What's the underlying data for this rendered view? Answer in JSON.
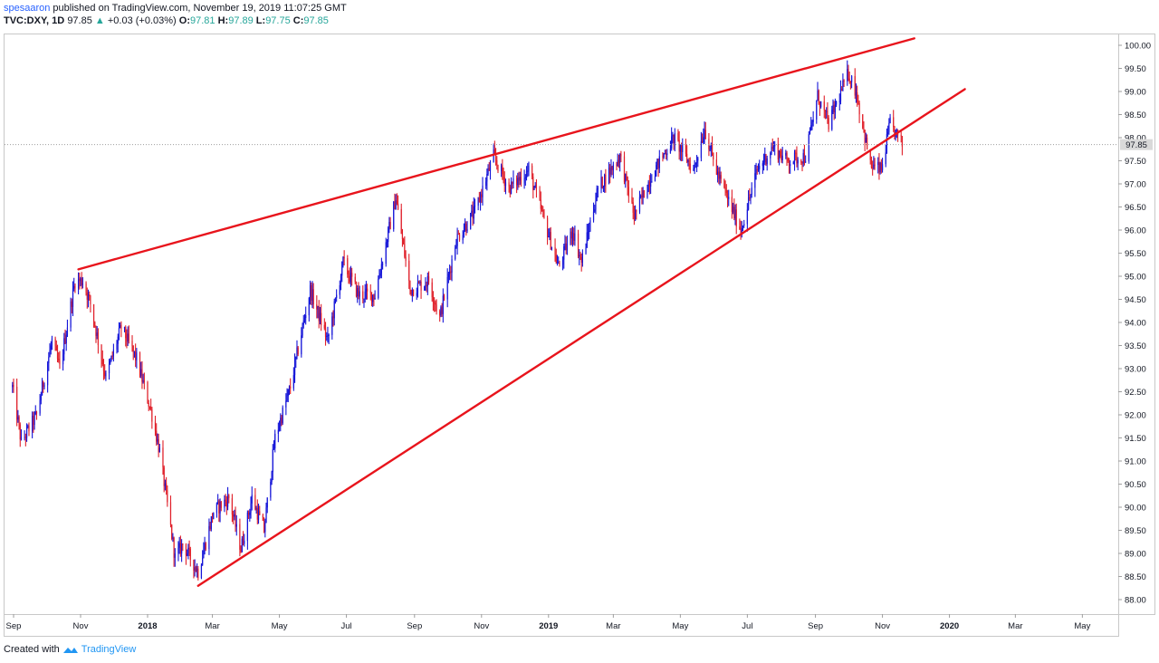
{
  "header": {
    "author": "spesaaron",
    "published_text": " published on TradingView.com, November 19, 2019 11:07:25 GMT",
    "symbol": "TVC:DXY, 1D",
    "last": "97.85",
    "change_arrow": "▲",
    "change": "+0.03 (+0.03%)",
    "o_label": "O:",
    "o_value": "97.81",
    "h_label": "H:",
    "h_value": "97.89",
    "l_label": "L:",
    "l_value": "97.75",
    "c_label": "C:",
    "c_value": "97.85"
  },
  "footer": {
    "created_with": "Created with",
    "brand": "TradingView"
  },
  "colors": {
    "up_candle": "#1515d8",
    "down_candle": "#e0202a",
    "trendline": "#e8141c",
    "price_label_bg": "#d9d9d9",
    "grid_border": "#c8c8c8"
  },
  "chart_data": {
    "type": "candlestick",
    "symbol": "TVC:DXY",
    "interval": "1D",
    "y_axis": {
      "min": 88.0,
      "max": 100.0,
      "ticks": [
        "100.00",
        "99.50",
        "99.00",
        "98.50",
        "98.00",
        "97.50",
        "97.00",
        "96.50",
        "96.00",
        "95.50",
        "95.00",
        "94.50",
        "94.00",
        "93.50",
        "93.00",
        "92.50",
        "92.00",
        "91.50",
        "91.00",
        "90.50",
        "90.00",
        "89.50",
        "89.00",
        "88.50",
        "88.00"
      ]
    },
    "x_axis": {
      "ticks": [
        "Sep",
        "Nov",
        "2018",
        "Mar",
        "May",
        "Jul",
        "Sep",
        "Nov",
        "2019",
        "Mar",
        "May",
        "Jul",
        "Sep",
        "Nov",
        "2020",
        "Mar",
        "May"
      ],
      "tick_dates": [
        "2017-09-01",
        "2017-11-01",
        "2018-01-01",
        "2018-03-01",
        "2018-05-01",
        "2018-07-01",
        "2018-09-01",
        "2018-11-01",
        "2019-01-01",
        "2019-03-01",
        "2019-05-01",
        "2019-07-01",
        "2019-09-01",
        "2019-11-01",
        "2020-01-01",
        "2020-03-01",
        "2020-05-01"
      ],
      "bold_ticks": [
        "2018",
        "2019",
        "2020"
      ]
    },
    "current_price_label": "97.85",
    "current_price": 97.85,
    "price_path": [
      [
        "2017-08-31",
        92.6
      ],
      [
        "2017-09-08",
        91.4
      ],
      [
        "2017-09-22",
        92.0
      ],
      [
        "2017-10-06",
        93.6
      ],
      [
        "2017-10-13",
        93.0
      ],
      [
        "2017-10-27",
        94.9
      ],
      [
        "2017-11-03",
        94.9
      ],
      [
        "2017-11-10",
        94.4
      ],
      [
        "2017-11-24",
        92.8
      ],
      [
        "2017-12-08",
        93.9
      ],
      [
        "2017-12-22",
        93.2
      ],
      [
        "2018-01-05",
        92.0
      ],
      [
        "2018-01-12",
        91.2
      ],
      [
        "2018-01-26",
        88.9
      ],
      [
        "2018-02-02",
        89.2
      ],
      [
        "2018-02-16",
        88.6
      ],
      [
        "2018-03-02",
        89.9
      ],
      [
        "2018-03-16",
        90.2
      ],
      [
        "2018-03-27",
        89.1
      ],
      [
        "2018-04-06",
        90.2
      ],
      [
        "2018-04-17",
        89.5
      ],
      [
        "2018-04-27",
        91.5
      ],
      [
        "2018-05-11",
        92.6
      ],
      [
        "2018-05-29",
        94.7
      ],
      [
        "2018-06-14",
        93.6
      ],
      [
        "2018-06-28",
        95.3
      ],
      [
        "2018-07-12",
        94.6
      ],
      [
        "2018-07-27",
        94.6
      ],
      [
        "2018-08-15",
        96.7
      ],
      [
        "2018-08-28",
        94.7
      ],
      [
        "2018-09-14",
        94.9
      ],
      [
        "2018-09-24",
        94.1
      ],
      [
        "2018-10-09",
        95.8
      ],
      [
        "2018-10-26",
        96.4
      ],
      [
        "2018-11-12",
        97.6
      ],
      [
        "2018-11-26",
        96.9
      ],
      [
        "2018-12-14",
        97.3
      ],
      [
        "2019-01-10",
        95.2
      ],
      [
        "2019-01-23",
        96.0
      ],
      [
        "2019-01-31",
        95.3
      ],
      [
        "2019-02-15",
        96.9
      ],
      [
        "2019-03-07",
        97.6
      ],
      [
        "2019-03-20",
        96.3
      ],
      [
        "2019-04-05",
        97.2
      ],
      [
        "2019-04-25",
        98.0
      ],
      [
        "2019-05-13",
        97.3
      ],
      [
        "2019-05-23",
        98.2
      ],
      [
        "2019-06-04",
        97.2
      ],
      [
        "2019-06-25",
        96.0
      ],
      [
        "2019-07-10",
        97.3
      ],
      [
        "2019-07-24",
        97.8
      ],
      [
        "2019-08-06",
        97.5
      ],
      [
        "2019-08-23",
        97.6
      ],
      [
        "2019-09-03",
        98.9
      ],
      [
        "2019-09-13",
        98.3
      ],
      [
        "2019-10-01",
        99.4
      ],
      [
        "2019-10-08",
        99.0
      ],
      [
        "2019-10-21",
        97.4
      ],
      [
        "2019-10-31",
        97.3
      ],
      [
        "2019-11-08",
        98.3
      ],
      [
        "2019-11-19",
        97.85
      ]
    ],
    "trendlines": [
      {
        "name": "upper",
        "from": [
          "2017-10-30",
          95.15
        ],
        "to": [
          "2019-11-30",
          100.15
        ]
      },
      {
        "name": "lower",
        "from": [
          "2018-02-16",
          88.3
        ],
        "to": [
          "2020-01-15",
          99.05
        ]
      }
    ]
  }
}
